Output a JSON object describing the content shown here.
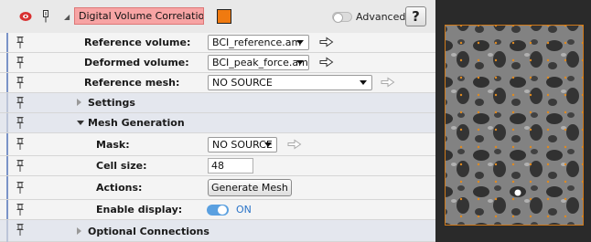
{
  "module": {
    "name": "Digital Volume Correlation",
    "color": "#f07a10",
    "advanced_label": "Advanced",
    "help_label": "?"
  },
  "rows": {
    "reference_volume": {
      "label": "Reference volume:",
      "value": "BCI_reference.am"
    },
    "deformed_volume": {
      "label": "Deformed volume:",
      "value": "BCI_peak_force.am"
    },
    "reference_mesh": {
      "label": "Reference mesh:",
      "value": "NO SOURCE"
    },
    "settings": {
      "label": "Settings"
    },
    "mesh_generation": {
      "label": "Mesh Generation"
    },
    "mask": {
      "label": "Mask:",
      "value": "NO SOURCE"
    },
    "cell_size": {
      "label": "Cell size:",
      "value": "48"
    },
    "actions": {
      "label": "Actions:",
      "button": "Generate Mesh"
    },
    "enable_display": {
      "label": "Enable display:",
      "state": "ON"
    },
    "optional_connections": {
      "label": "Optional Connections"
    }
  },
  "colors": {
    "module_name_bg": "#f7a4a4",
    "row_accent": "#7a93c8",
    "mesh_outline": "#d07a1a",
    "toggle_on": "#5aa0e0"
  }
}
